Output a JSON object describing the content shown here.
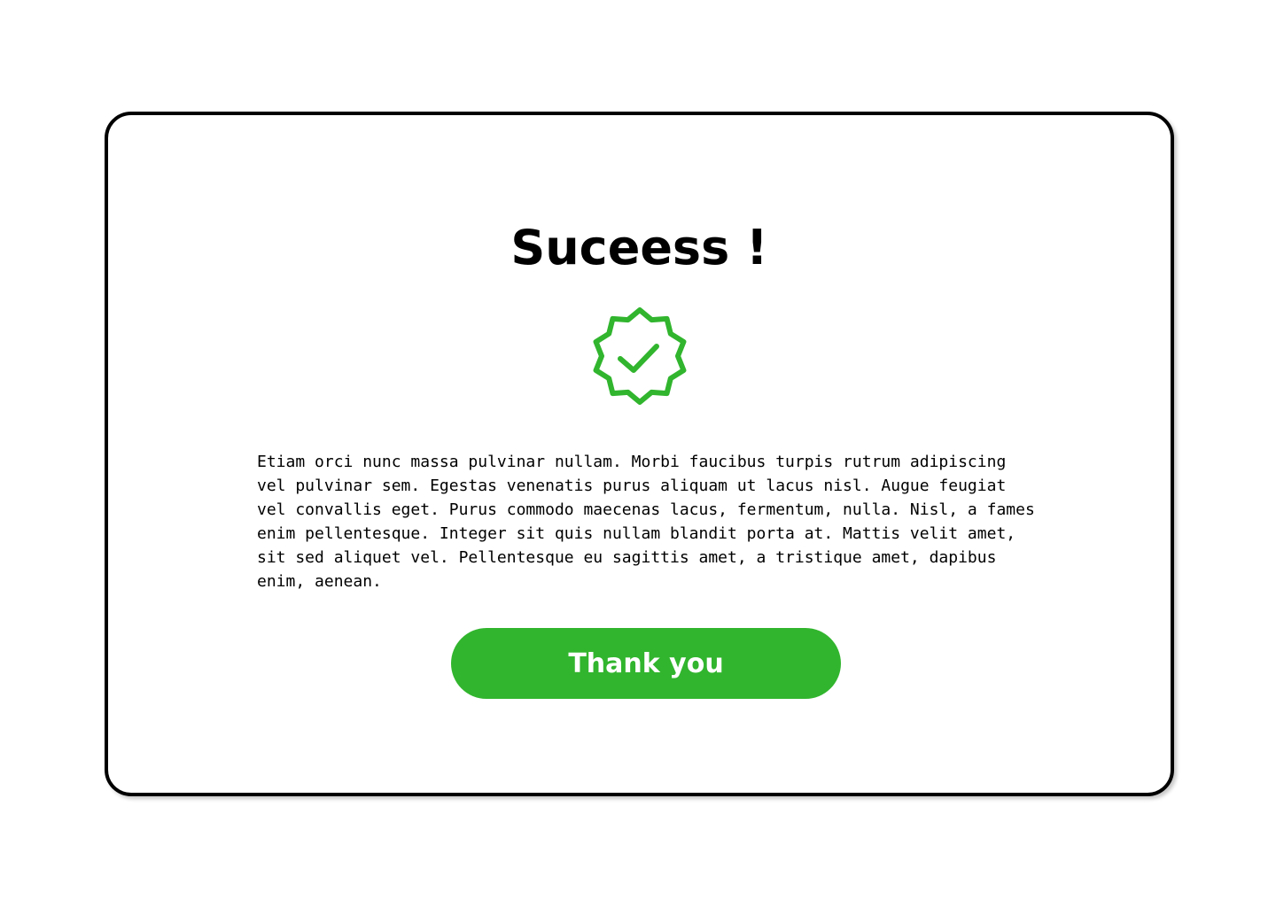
{
  "dialog": {
    "title": "Suceess !",
    "badge_icon": "verified-check-badge-icon",
    "message": "Etiam orci nunc massa pulvinar nullam. Morbi faucibus turpis rutrum adipiscing\nvel pulvinar sem. Egestas venenatis purus aliquam ut lacus nisl. Augue feugiat\nvel convallis eget. Purus commodo maecenas lacus, fermentum, nulla. Nisl, a fames\nenim pellentesque. Integer sit quis nullam blandit porta at. Mattis velit amet,\nsit sed aliquet vel. Pellentesque eu sagittis amet, a tristique amet, dapibus\nenim, aenean.",
    "button_label": "Thank you"
  },
  "colors": {
    "accent": "#31b52e",
    "border": "#000000",
    "background": "#ffffff"
  }
}
